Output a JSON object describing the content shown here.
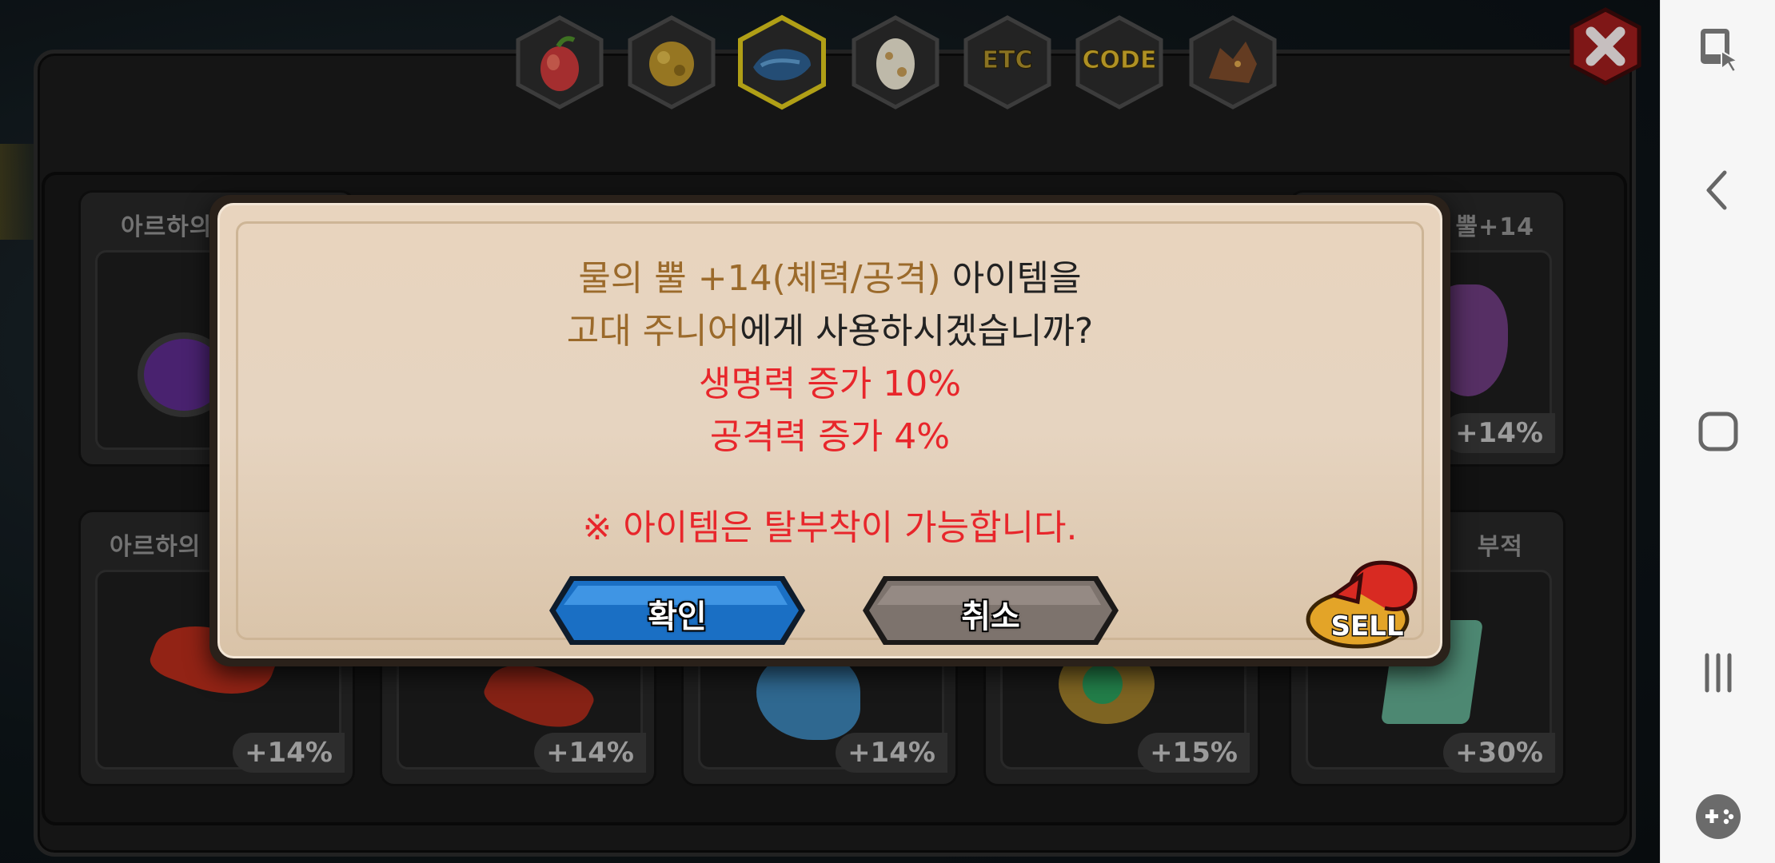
{
  "tabs": [
    {
      "name": "fruit-tab",
      "icon": "fruit-icon"
    },
    {
      "name": "ore-tab",
      "icon": "ore-icon"
    },
    {
      "name": "dragon-scale-tab",
      "icon": "scale-icon",
      "selected": true
    },
    {
      "name": "egg-tab",
      "icon": "egg-icon"
    },
    {
      "name": "etc-tab",
      "label": "ETC"
    },
    {
      "name": "code-tab",
      "label": "CODE"
    },
    {
      "name": "dragon-tab",
      "icon": "dragon-head-icon"
    }
  ],
  "cards_row1": [
    {
      "name": "아르하의",
      "pct": ""
    },
    {
      "name": "",
      "pct": ""
    },
    {
      "name": "",
      "pct": ""
    },
    {
      "name": "",
      "pct": ""
    },
    {
      "name": "뿔+14",
      "pct": "+14%"
    }
  ],
  "cards_row2": [
    {
      "name": "아르하의",
      "pct": "+14%"
    },
    {
      "name": "",
      "pct": "+14%"
    },
    {
      "name": "",
      "pct": "+14%"
    },
    {
      "name": "",
      "pct": "+15%"
    },
    {
      "name": "부적",
      "pct": "+30%"
    }
  ],
  "dialog": {
    "line1_item": "물의 뿔 +14(체력/공격)",
    "line1_rest": " 아이템을",
    "line2_target": "고대 주니어",
    "line2_rest": "에게 사용하시겠습니까?",
    "stat1": "생명력 증가 10%",
    "stat2": "공격력 증가 4%",
    "note": "※ 아이템은 탈부착이 가능합니다.",
    "confirm_label": "확인",
    "cancel_label": "취소",
    "sell_label": "SELL"
  },
  "colors": {
    "confirm": "#1a6fc4",
    "cancel": "#7d736d",
    "highlight": "#9b6a2b",
    "warning": "#e8262b"
  },
  "navbar": {
    "icons": [
      "screen-pin-icon",
      "back-icon",
      "home-icon",
      "recents-icon",
      "game-tools-icon"
    ]
  }
}
